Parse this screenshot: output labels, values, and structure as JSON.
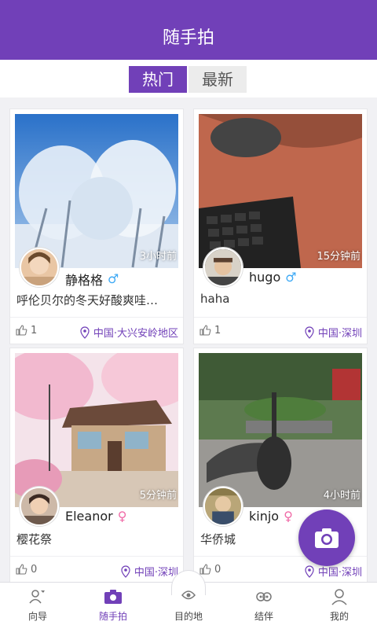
{
  "header": {
    "title": "随手拍"
  },
  "tabs": [
    {
      "label": "热门",
      "active": true
    },
    {
      "label": "最新",
      "active": false
    }
  ],
  "cards": [
    {
      "username": "静格格",
      "gender": "male",
      "gender_symbol": "♂",
      "time_ago": "3小时前",
      "caption": "呼伦贝尔的冬天好酸爽哇…",
      "likes": "1",
      "location": "中国·大兴安岭地区"
    },
    {
      "username": "hugo",
      "gender": "male",
      "gender_symbol": "♂",
      "time_ago": "15分钟前",
      "caption": "haha",
      "likes": "1",
      "location": "中国·深圳"
    },
    {
      "username": "Eleanor",
      "gender": "female",
      "gender_symbol": "♀",
      "time_ago": "5分钟前",
      "caption": "樱花祭",
      "likes": "0",
      "location": "中国·深圳"
    },
    {
      "username": "kinjo",
      "gender": "female",
      "gender_symbol": "♀",
      "time_ago": "4小时前",
      "caption": "华侨城",
      "likes": "0",
      "location": "中国·深圳"
    }
  ],
  "bottom_nav": [
    {
      "label": "向导",
      "icon": "guide-icon",
      "active": false
    },
    {
      "label": "随手拍",
      "icon": "camera-icon",
      "active": true
    },
    {
      "label": "目的地",
      "icon": "destination-icon",
      "active": false
    },
    {
      "label": "结伴",
      "icon": "companion-icon",
      "active": false
    },
    {
      "label": "我的",
      "icon": "profile-icon",
      "active": false
    }
  ],
  "colors": {
    "primary": "#7140b8",
    "male": "#3da9f5",
    "female": "#f06aa7"
  }
}
